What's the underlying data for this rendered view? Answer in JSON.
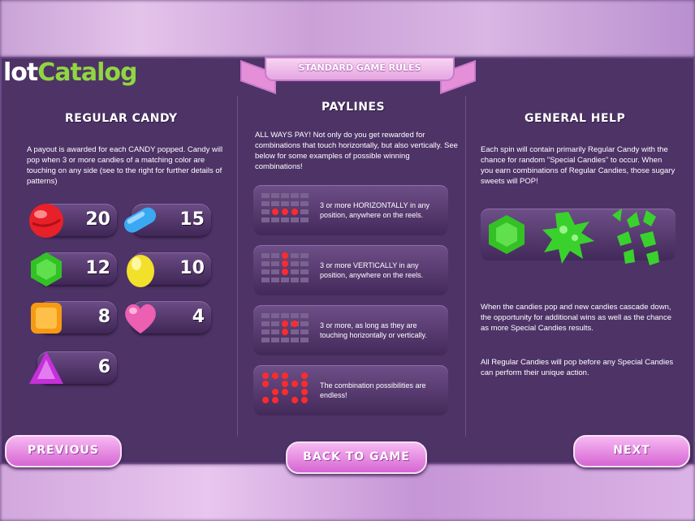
{
  "watermark": {
    "part1": "lot",
    "part2": "Catalog"
  },
  "ribbon_title": "STANDARD GAME RULES",
  "regular_candy": {
    "title": "REGULAR CANDY",
    "description": "A payout is awarded for each CANDY popped. Candy will pop when 3 or more candies of a matching color are touching on any side (see to the right for further details of patterns)",
    "candies": [
      {
        "name": "red",
        "value": "20",
        "color": "#e8202a"
      },
      {
        "name": "blue",
        "value": "15",
        "color": "#39a9f2"
      },
      {
        "name": "green",
        "value": "12",
        "color": "#33c126"
      },
      {
        "name": "yellow",
        "value": "10",
        "color": "#f3e02b"
      },
      {
        "name": "orange",
        "value": "8",
        "color": "#f59a12"
      },
      {
        "name": "pink",
        "value": "4",
        "color": "#ec5fb1"
      },
      {
        "name": "purple",
        "value": "6",
        "color": "#c530d8"
      }
    ]
  },
  "paylines": {
    "title": "PAYLINES",
    "description": "ALL WAYS PAY! Not only do you get rewarded for combinations that touch horizontally, but also vertically. See below for some examples of possible winning combinations!",
    "rows": [
      {
        "text": "3 or more HORIZONTALLY in any position, anywhere on the reels."
      },
      {
        "text": "3 or more VERTICALLY in any position, anywhere on the reels."
      },
      {
        "text": "3 or more, as long as they are touching horizontally or vertically."
      },
      {
        "text": "The combination possibilities are endless!"
      }
    ]
  },
  "general_help": {
    "title": "GENERAL HELP",
    "paragraph1": "Each spin will contain primarily Regular Candy with the chance for random \"Special Candies\" to occur. When you earn combinations of Regular Candies, those sugary sweets will POP!",
    "paragraph2": "When the candies pop and new candies cascade down, the opportunity for additional wins as well as the chance as more Special Candies results.",
    "paragraph3": "All Regular Candies will pop before any Special Candies can perform their unique action."
  },
  "buttons": {
    "previous": "PREVIOUS",
    "back": "BACK TO GAME",
    "next": "NEXT"
  }
}
